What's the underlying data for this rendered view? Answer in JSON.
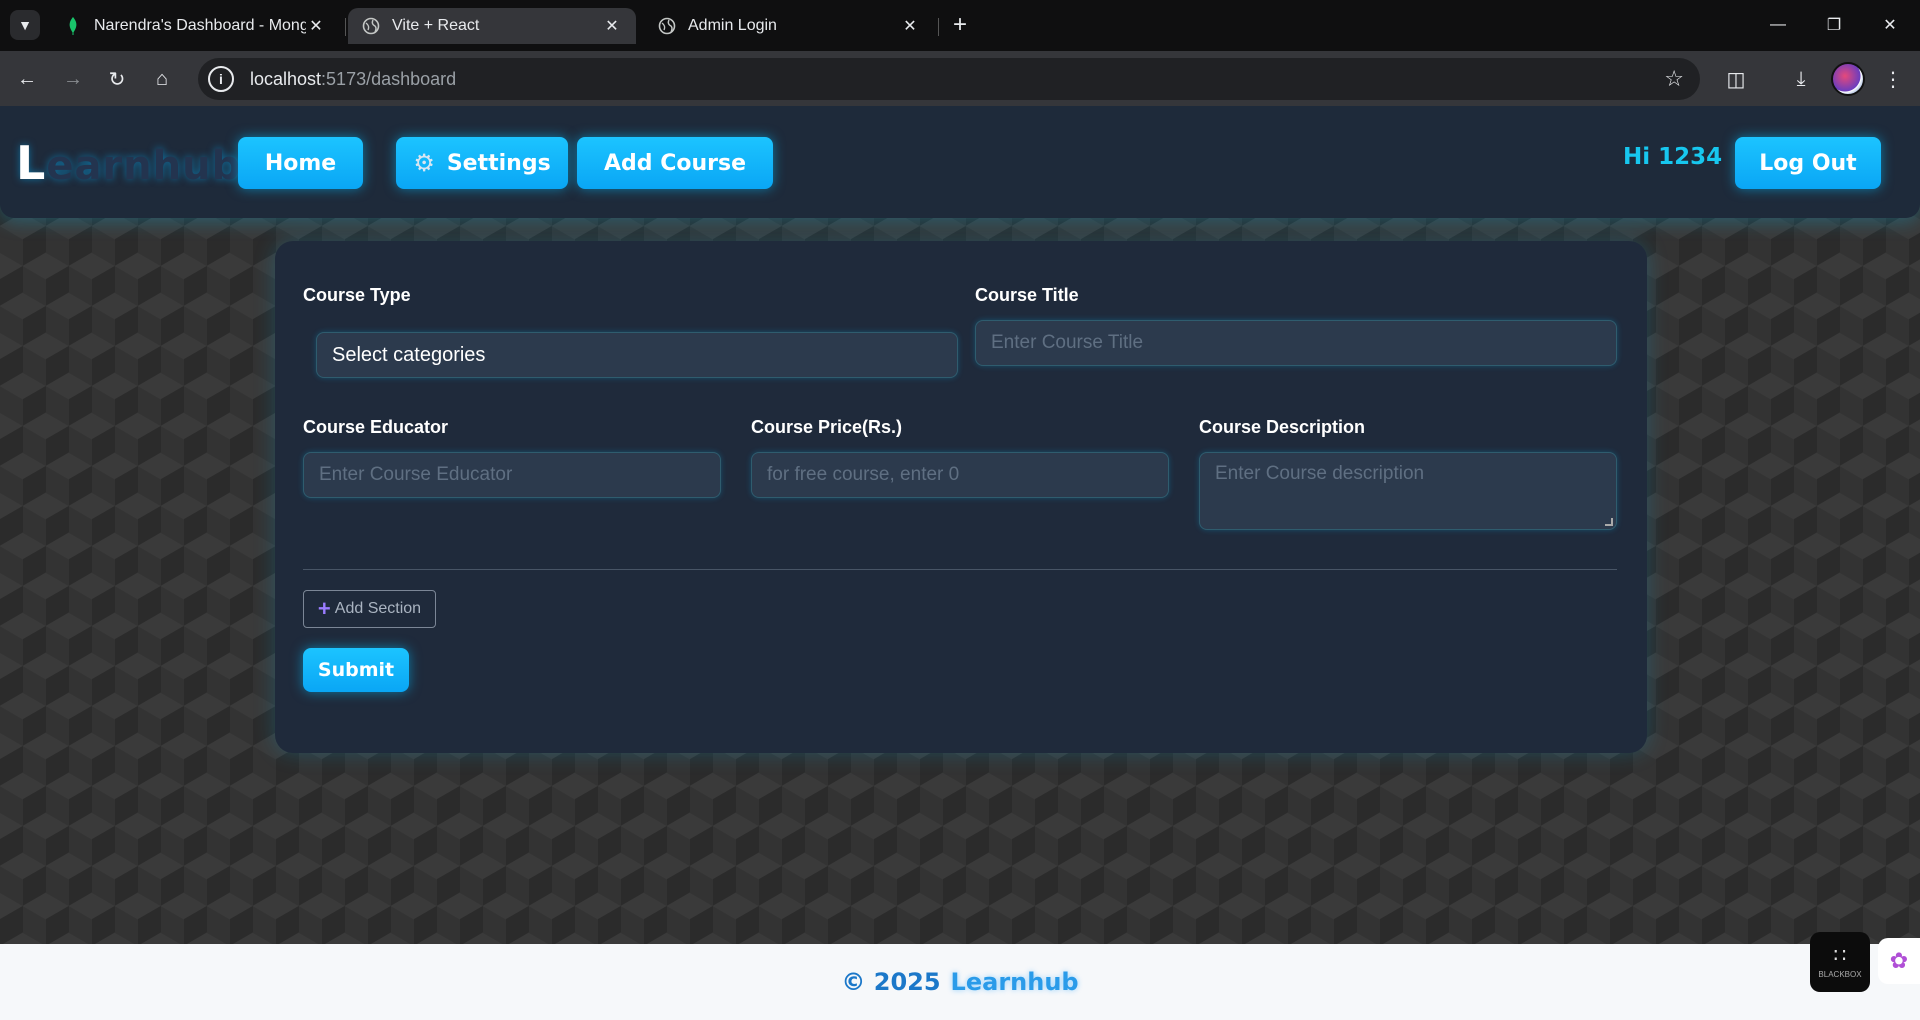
{
  "browser": {
    "tabs": [
      {
        "title": "Narendra's Dashboard - MongoDB",
        "icon": "mongodb-leaf-icon",
        "active": false
      },
      {
        "title": "Vite + React",
        "icon": "globe-icon",
        "active": true
      },
      {
        "title": "Admin Login",
        "icon": "globe-icon",
        "active": false
      }
    ],
    "url_host": "localhost",
    "url_rest": ":5173/dashboard"
  },
  "navbar": {
    "brand_first": "L",
    "brand_rest": "earnhub",
    "home_label": "Home",
    "settings_label": "Settings",
    "add_course_label": "Add Course",
    "greeting": "Hi 1234",
    "logout_label": "Log Out"
  },
  "form": {
    "course_type": {
      "label": "Course Type",
      "value": "Select categories"
    },
    "course_title": {
      "label": "Course Title",
      "placeholder": "Enter Course Title"
    },
    "course_educator": {
      "label": "Course Educator",
      "placeholder": "Enter Course Educator"
    },
    "course_price": {
      "label": "Course Price(Rs.)",
      "placeholder": "for free course, enter 0"
    },
    "course_description": {
      "label": "Course Description",
      "placeholder": "Enter Course description"
    },
    "add_section_label": "Add Section",
    "submit_label": "Submit"
  },
  "footer": {
    "copyright": "© 2025",
    "brand": "Learnhub"
  },
  "extensions": {
    "blackbox_label": "BLACKBOX"
  },
  "colors": {
    "accent": "#0aa6f5",
    "navbar_bg": "#1e2a3a",
    "card_bg": "#1f2a3b",
    "greeting": "#17c7ef"
  }
}
